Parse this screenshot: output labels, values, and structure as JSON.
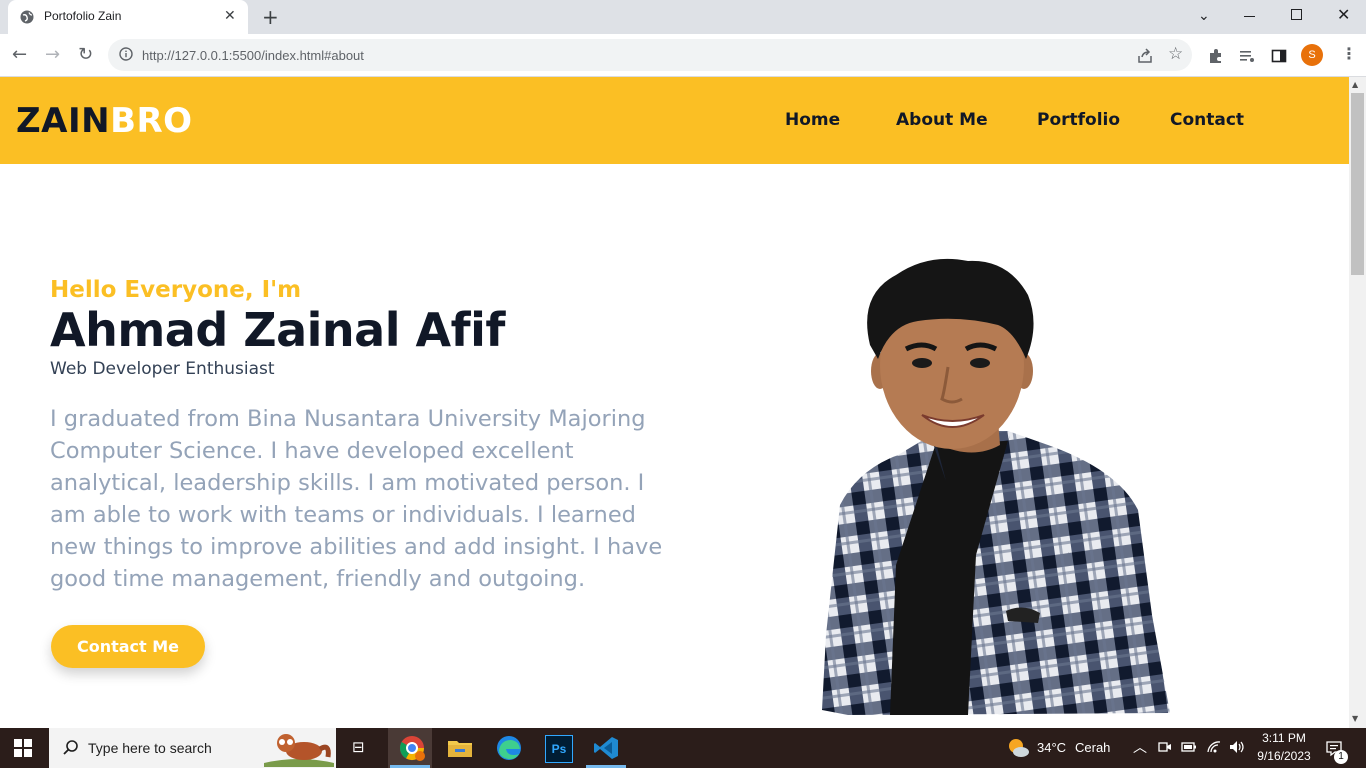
{
  "browser": {
    "tab_title": "Portofolio Zain",
    "url": "http://127.0.0.1:5500/index.html#about",
    "profile_initial": "S"
  },
  "site": {
    "logo_dark": "ZAIN",
    "logo_light": "BRO",
    "nav": [
      "Home",
      "About Me",
      "Portfolio",
      "Contact"
    ]
  },
  "hero": {
    "greeting": "Hello Everyone, I'm",
    "name": "Ahmad Zainal Afif",
    "role": "Web Developer Enthusiast",
    "bio": "I graduated from Bina Nusantara University Majoring Computer Science. I have developed excellent analytical, leadership skills. I am motivated person. I am able to work with teams or individuals. I learned new things to improve abilities and add insight. I have good time management, friendly and outgoing.",
    "cta": "Contact Me"
  },
  "taskbar": {
    "search_placeholder": "Type here to search",
    "weather_temp": "34°C",
    "weather_desc": "Cerah",
    "time": "3:11 PM",
    "date": "9/16/2023",
    "notification_count": "1"
  },
  "colors": {
    "accent": "#fbbf24",
    "dark": "#111827",
    "muted": "#94a3b8"
  }
}
